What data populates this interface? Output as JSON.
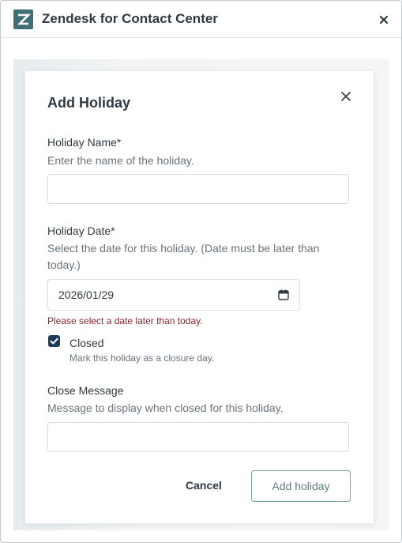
{
  "window": {
    "title": "Zendesk for Contact Center",
    "icons": {
      "logo": "zendesk-logo",
      "close": "close-icon"
    }
  },
  "modal": {
    "title": "Add Holiday",
    "holiday_name": {
      "label": "Holiday Name*",
      "hint": "Enter the name of the holiday.",
      "value": "",
      "placeholder": ""
    },
    "holiday_date": {
      "label": "Holiday Date*",
      "hint": "Select the date for this holiday. (Date must be later than today.)",
      "value": "2026/01/29",
      "error": "Please select a date later than today."
    },
    "closed": {
      "checked": true,
      "label": "Closed",
      "hint": "Mark this holiday as a closure day."
    },
    "close_message": {
      "label": "Close Message",
      "hint": "Message to display when closed for this holiday.",
      "value": "",
      "placeholder": ""
    },
    "buttons": {
      "cancel": "Cancel",
      "add": "Add holiday"
    }
  },
  "colors": {
    "brand": "#3f6f74",
    "error": "#8c232c",
    "checkbox": "#1f3d5a",
    "primary_outline": "#7fa2a8"
  }
}
